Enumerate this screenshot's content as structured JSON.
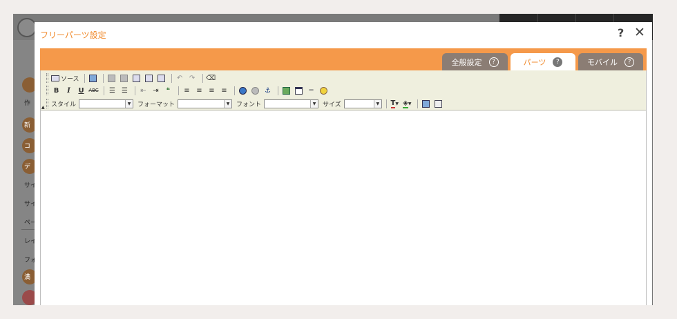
{
  "background": {
    "sidebar_items": [
      "新",
      "コ",
      "デ",
      "サイ",
      "サイ",
      "ペー",
      "レイ",
      "フォ",
      "満"
    ],
    "create_label": "作"
  },
  "modal": {
    "title": "フリーパーツ設定",
    "help_label": "?",
    "close_label": "✕",
    "tabs": [
      {
        "label": "全般設定",
        "icon": "question-circle-icon",
        "active": false
      },
      {
        "label": "パーツ",
        "icon": "question-circle-icon",
        "active": true
      },
      {
        "label": "モバイル",
        "icon": "question-circle-icon",
        "active": false
      }
    ],
    "accent_color": "#f5994a",
    "title_color": "#f08a2c"
  },
  "toolbar": {
    "source_label": "ソース",
    "bold": "B",
    "italic": "I",
    "underline": "U",
    "strike": "ABC",
    "style_label": "スタイル",
    "format_label": "フォーマット",
    "font_label": "フォント",
    "size_label": "サイズ",
    "style_value": "",
    "format_value": "",
    "font_value": "",
    "size_value": ""
  }
}
